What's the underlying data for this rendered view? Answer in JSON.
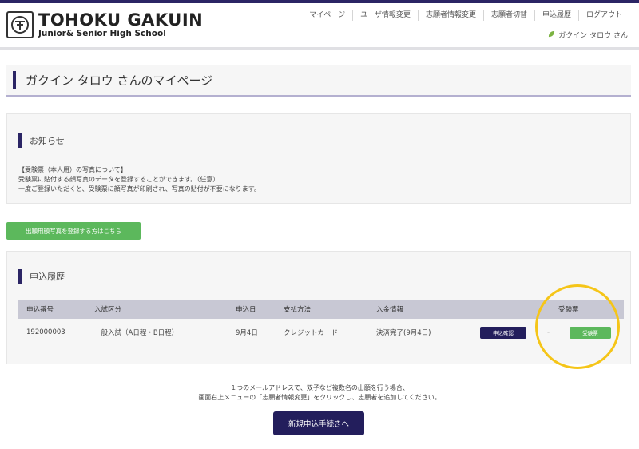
{
  "header": {
    "logo_title": "TOHOKU GAKUIN",
    "logo_subtitle": "Junior& Senior High School",
    "nav": [
      "マイページ",
      "ユーザ情報変更",
      "志願者情報変更",
      "志願者切替",
      "申込履歴",
      "ログアウト"
    ],
    "user_name": "ガクイン タロウ さん"
  },
  "page": {
    "title": "ガクイン タロウ さんのマイページ"
  },
  "notice": {
    "heading": "お知らせ",
    "lines": [
      "【受験票（本人用）の写真について】",
      "受験票に貼付する顔写真のデータを登録することができます。（任意）",
      "一度ご登録いただくと、受験票に顔写真が印刷され、写真の貼付が不要になります。"
    ]
  },
  "photo_button": "出願用顔写真を登録する方はこちら",
  "history": {
    "heading": "申込履歴",
    "columns": [
      "申込番号",
      "入試区分",
      "申込日",
      "支払方法",
      "入金情報",
      "受験票"
    ],
    "row": {
      "number": "192000003",
      "category": "一般入試（A日程・B日程）",
      "date": "9月4日",
      "payment": "クレジットカード",
      "status": "決済完了(9月4日)",
      "detail_button": "申込確認",
      "dash": "-",
      "ticket_button": "受験票"
    }
  },
  "footer": {
    "line1": "１つのメールアドレスで、双子など複数名の出願を行う場合、",
    "line2": "画面右上メニューの「志願者情報変更」をクリックし、志願者を追加してください。",
    "new_button": "新規申込手続きへ"
  },
  "colors": {
    "navy": "#231e5c",
    "green": "#5cb85c",
    "highlight": "#f5c518"
  }
}
